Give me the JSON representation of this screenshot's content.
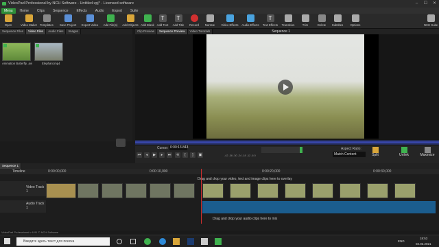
{
  "window": {
    "title": "VideoPad Professional by NCH Software - Untitled.vpj* - Licensed software"
  },
  "menu": {
    "main": "Menu",
    "items": [
      "Home",
      "Clips",
      "Sequence",
      "Effects",
      "Audio",
      "Export",
      "Suite"
    ]
  },
  "toolbar": [
    {
      "label": "Open",
      "icon": "folder-icon",
      "color": "#d9a63a"
    },
    {
      "label": "Video Maker",
      "icon": "magic-wand-icon",
      "color": "#d9a63a"
    },
    {
      "label": "Templates",
      "icon": "templates-icon",
      "color": "#888"
    },
    {
      "label": "Save Project",
      "icon": "save-icon",
      "color": "#5b8fd6"
    },
    {
      "label": "Export Video",
      "icon": "export-icon",
      "color": "#5b8fd6"
    },
    {
      "label": "Add File(s)",
      "icon": "add-file-icon",
      "color": "#3fb24f"
    },
    {
      "label": "Add Objects",
      "icon": "add-objects-icon",
      "color": "#d9a63a"
    },
    {
      "label": "Add Blank",
      "icon": "add-blank-icon",
      "color": "#3fb24f"
    },
    {
      "label": "Add Text",
      "icon": "text-icon",
      "color": "#eee"
    },
    {
      "label": "Add Title",
      "icon": "title-icon",
      "color": "#eee"
    },
    {
      "label": "Record",
      "icon": "record-icon",
      "color": "#d03030"
    },
    {
      "label": "Narrate",
      "icon": "microphone-icon",
      "color": "#aaa"
    },
    {
      "label": "Video Effects",
      "icon": "video-effects-icon",
      "color": "#4aa3df"
    },
    {
      "label": "Audio Effects",
      "icon": "audio-effects-icon",
      "color": "#4aa3df"
    },
    {
      "label": "Text Effects",
      "icon": "text-effects-icon",
      "color": "#eee"
    },
    {
      "label": "Transition",
      "icon": "transition-icon",
      "color": "#aaa"
    },
    {
      "label": "Trim",
      "icon": "trim-icon",
      "color": "#aaa"
    },
    {
      "label": "Delete",
      "icon": "delete-icon",
      "color": "#888"
    },
    {
      "label": "Subtitles",
      "icon": "subtitles-icon",
      "color": "#aaa"
    },
    {
      "label": "Options",
      "icon": "options-icon",
      "color": "#aaa"
    },
    {
      "label": "NCH Suite",
      "icon": "nch-suite-icon",
      "color": "#aaa"
    }
  ],
  "bin": {
    "tabs": [
      "Sequence Files",
      "Video Files",
      "Audio Files",
      "Images"
    ],
    "items": [
      {
        "name": "Animation Butterfly .avi"
      },
      {
        "name": "Elephant.mp4"
      }
    ]
  },
  "preview": {
    "tabs": [
      "Clip Preview",
      "Sequence Preview",
      "Video Tutorials"
    ],
    "sequence_title": "Sequence 1",
    "cursor_label": "Cursor:",
    "cursor_value": "0:00:13.843",
    "meter_scale": "-42  -36  -30  -24  -18  -12  -6  0",
    "aspect_label": "Aspect Ratio:",
    "aspect_value": "Match Content",
    "split_label": "Split",
    "unlink_label": "Unlink",
    "maximize_label": "Maximize"
  },
  "timeline": {
    "tab": "Sequence 1",
    "ruler_label": "Timeline",
    "ticks": [
      "0:00:00,000",
      "0:00:10,000",
      "0:00:20,000",
      "0:00:30,000"
    ],
    "video_track": "Video Track 1",
    "audio_track": "Audio Track 1",
    "overlay_hint": "Drag and drop your video, text and image clips here to overlay",
    "audio_hint": "Drag and drop your audio clips here to mix"
  },
  "status": "VideoPad Professional v 6.91 © NCH Software",
  "taskbar": {
    "search_placeholder": "Введите здесь текст для поиска",
    "lang": "ENG",
    "time": "18:53",
    "date": "02.03.2021"
  }
}
